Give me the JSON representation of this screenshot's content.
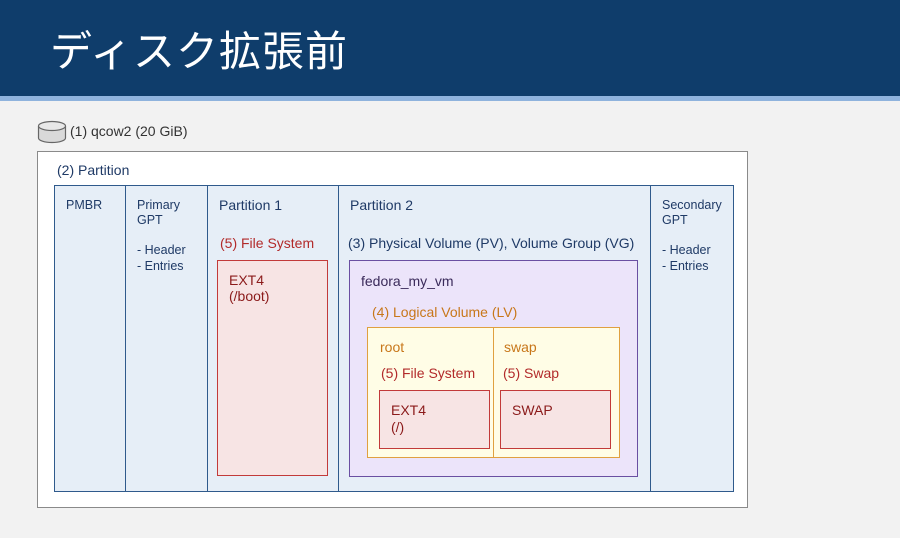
{
  "title": "ディスク拡張前",
  "disk": {
    "label": "(1) qcow2 (20 GiB)",
    "icon": "disk-cylinder-icon"
  },
  "partition_table": {
    "label": "(2) Partition",
    "pmbr": "PMBR",
    "primary_gpt": {
      "title_line1": "Primary",
      "title_line2": "GPT",
      "item1": "- Header",
      "item2": "- Entries"
    },
    "partition1": {
      "label": "Partition 1",
      "fs_label": "(5) File System",
      "fs_line1": "EXT4",
      "fs_line2": "(/boot)"
    },
    "partition2": {
      "label": "Partition 2",
      "pv_label": "(3) Physical Volume (PV), Volume Group (VG)",
      "vg_name": "fedora_my_vm",
      "lv_label": "(4) Logical Volume (LV)",
      "root": {
        "name": "root",
        "fs_label": "(5) File System",
        "fs_line1": "EXT4",
        "fs_line2": "(/)"
      },
      "swap": {
        "name": "swap",
        "fs_label": "(5) Swap",
        "fs_line1": "SWAP"
      }
    },
    "secondary_gpt": {
      "title_line1": "Secondary",
      "title_line2": "GPT",
      "item1": "- Header",
      "item2": "- Entries"
    }
  },
  "colors": {
    "header": "#0f3d6b",
    "partition_border": "#2f5a8c",
    "filesystem_border": "#c23a3a",
    "volume_group_border": "#6a4fa2",
    "logical_volume_border": "#e0a040"
  }
}
